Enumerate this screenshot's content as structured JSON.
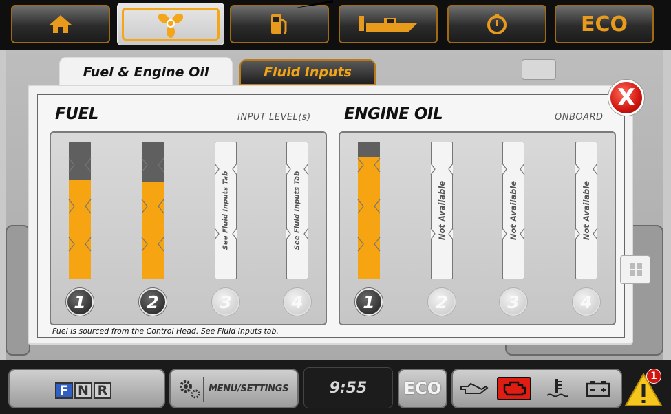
{
  "top_nav": {
    "items": [
      {
        "name": "home",
        "icon": "home-icon"
      },
      {
        "name": "propeller",
        "icon": "propeller-icon"
      },
      {
        "name": "fuel",
        "icon": "fuel-pump-icon"
      },
      {
        "name": "boat",
        "icon": "boat-icon"
      },
      {
        "name": "gauge",
        "icon": "gauge-icon"
      },
      {
        "name": "eco",
        "label": "ECO"
      }
    ],
    "active_index": 1,
    "accent_color": "#f4a61a"
  },
  "tabs": [
    {
      "label": "Fuel & Engine Oil",
      "active": true
    },
    {
      "label": "Fluid Inputs",
      "active": false
    }
  ],
  "fuel": {
    "title": "FUEL",
    "subtitle": "INPUT LEVEL(s)",
    "tanks": [
      {
        "number": "1",
        "level": 0.72,
        "active": true
      },
      {
        "number": "2",
        "level": 0.71,
        "active": true
      },
      {
        "number": "3",
        "active": false,
        "text": "See Fluid Inputs Tab"
      },
      {
        "number": "4",
        "active": false,
        "text": "See Fluid Inputs Tab"
      }
    ],
    "note": "Fuel is sourced from the Control Head. See Fluid Inputs tab."
  },
  "engine_oil": {
    "title": "ENGINE OIL",
    "subtitle": "ONBOARD",
    "tanks": [
      {
        "number": "1",
        "level": 0.89,
        "active": true
      },
      {
        "number": "2",
        "active": false,
        "text": "Not Available"
      },
      {
        "number": "3",
        "active": false,
        "text": "Not Available"
      },
      {
        "number": "4",
        "active": false,
        "text": "Not Available"
      }
    ]
  },
  "close_label": "X",
  "bottom_bar": {
    "fnr": [
      "F",
      "N",
      "R"
    ],
    "fnr_active": "F",
    "menu_label": "MENU/SETTINGS",
    "time": "9:55",
    "eco_label": "ECO",
    "warnings": [
      "oil-pressure-icon",
      "check-engine-icon",
      "coolant-temp-icon",
      "battery-icon"
    ],
    "alert_count": "1"
  }
}
